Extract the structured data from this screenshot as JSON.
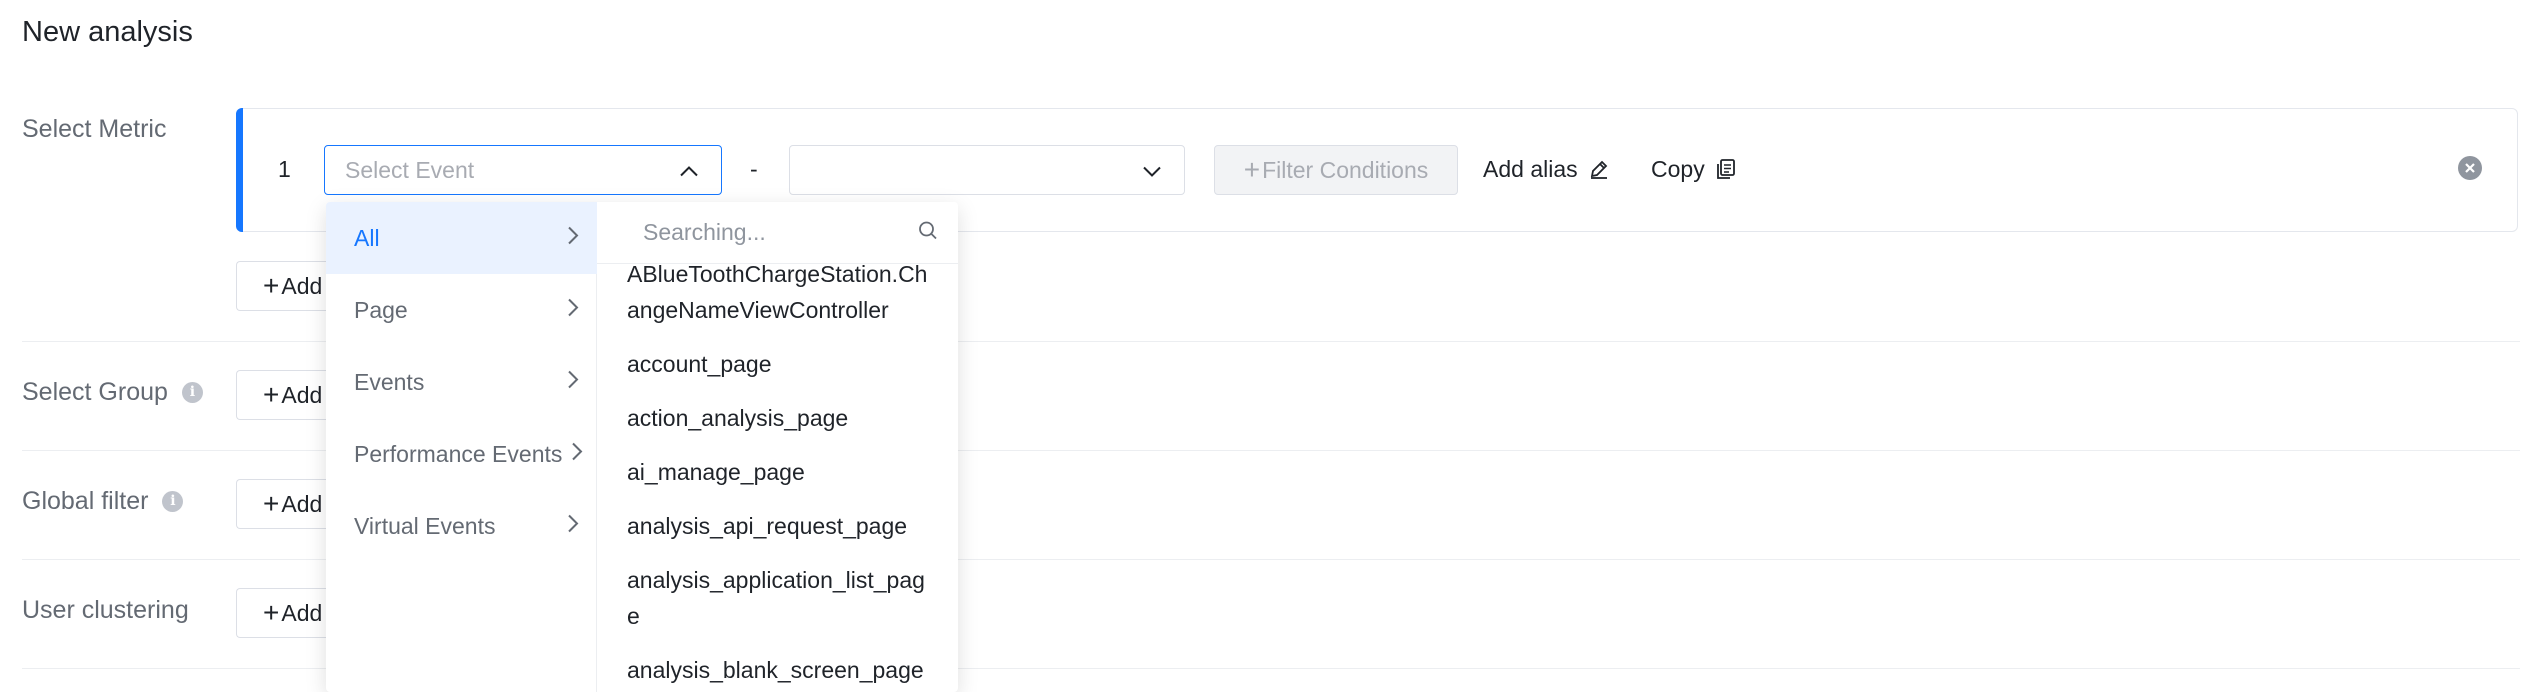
{
  "page": {
    "title": "New analysis"
  },
  "sections": {
    "metric": {
      "label": "Select Metric"
    },
    "group": {
      "label": "Select Group"
    },
    "global_filter": {
      "label": "Global filter"
    },
    "clustering": {
      "label": "User clustering"
    }
  },
  "metric_row": {
    "index": "1",
    "event_select": {
      "placeholder": "Select Event",
      "state": "open"
    },
    "separator": "-",
    "second_select": {
      "value": ""
    },
    "filter_button": "Filter Conditions",
    "add_alias": "Add alias",
    "copy": "Copy"
  },
  "add_button_label": "Add",
  "dropdown": {
    "categories": [
      {
        "label": "All",
        "active": true
      },
      {
        "label": "Page",
        "active": false
      },
      {
        "label": "Events",
        "active": false
      },
      {
        "label": "Performance Events",
        "active": false
      },
      {
        "label": "Virtual Events",
        "active": false
      }
    ],
    "search_placeholder": "Searching...",
    "events": [
      "ABlueToothChargeStation.ChangeNameViewController",
      "account_page",
      "action_analysis_page",
      "ai_manage_page",
      "analysis_api_request_page",
      "analysis_application_list_page",
      "analysis_blank_screen_page"
    ]
  },
  "colors": {
    "accent": "#1677ff",
    "muted_text": "#646a73",
    "border": "#dcdfe6",
    "active_bg": "#eaf2ff"
  },
  "icons": [
    "chevron-up-icon",
    "chevron-down-icon",
    "plus-icon",
    "pencil-icon",
    "copy-icon",
    "close-circle-icon",
    "info-icon",
    "chevron-right-icon",
    "search-icon"
  ]
}
